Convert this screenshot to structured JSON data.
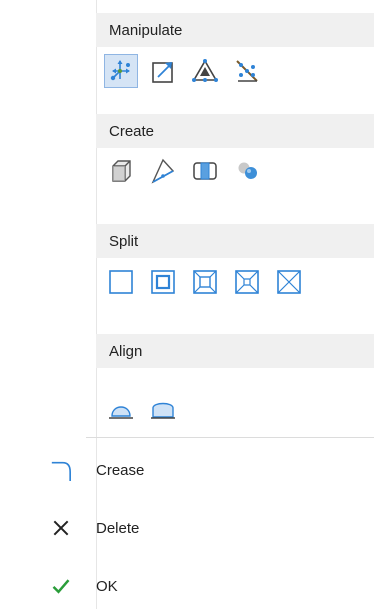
{
  "sections": {
    "manipulate": {
      "label": "Manipulate",
      "tools": [
        "move-gizmo-icon",
        "scale-box-icon",
        "triangle-vertices-icon",
        "edge-slide-icon"
      ]
    },
    "create": {
      "label": "Create",
      "tools": [
        "box-icon",
        "plane-icon",
        "bridge-icon",
        "spheres-icon"
      ]
    },
    "split": {
      "label": "Split",
      "tools": [
        "split-square-1-icon",
        "split-square-2-icon",
        "split-square-3-icon",
        "split-square-4-icon",
        "split-square-5-icon"
      ]
    },
    "align": {
      "label": "Align",
      "tools": [
        "align-arc-1-icon",
        "align-arc-2-icon"
      ]
    }
  },
  "commands": [
    {
      "label": "Crease",
      "icon": "crease-icon"
    },
    {
      "label": "Delete",
      "icon": "delete-x-icon"
    },
    {
      "label": "OK",
      "icon": "checkmark-icon"
    }
  ],
  "colors": {
    "accent": "#2f83d6",
    "header_bg": "#f0f0f0",
    "ok_green": "#2a9d3a",
    "active_bg": "#d5e4f5"
  }
}
